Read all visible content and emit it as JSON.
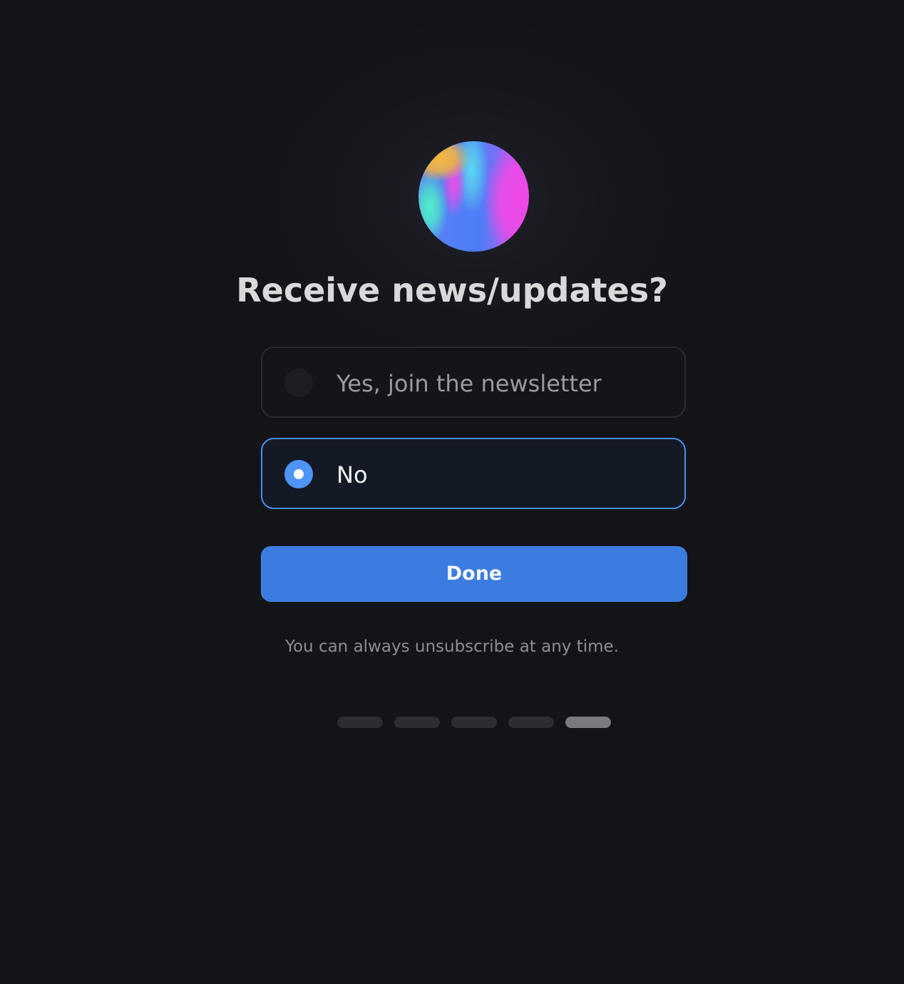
{
  "title": "Receive news/updates?",
  "options": [
    {
      "label": "Yes, join the newsletter",
      "selected": false
    },
    {
      "label": "No",
      "selected": true
    }
  ],
  "done_button": {
    "label": "Done"
  },
  "note": "You can always unsubscribe at any time.",
  "pagination": {
    "total_steps": 5,
    "current_step": 5
  },
  "colors": {
    "background": "#131418",
    "accent": "#3b7ce0",
    "selected_border": "#4a8ef0",
    "radio_on": "#4f94f6"
  },
  "icons": {
    "logo": "gradient-orb-logo"
  }
}
